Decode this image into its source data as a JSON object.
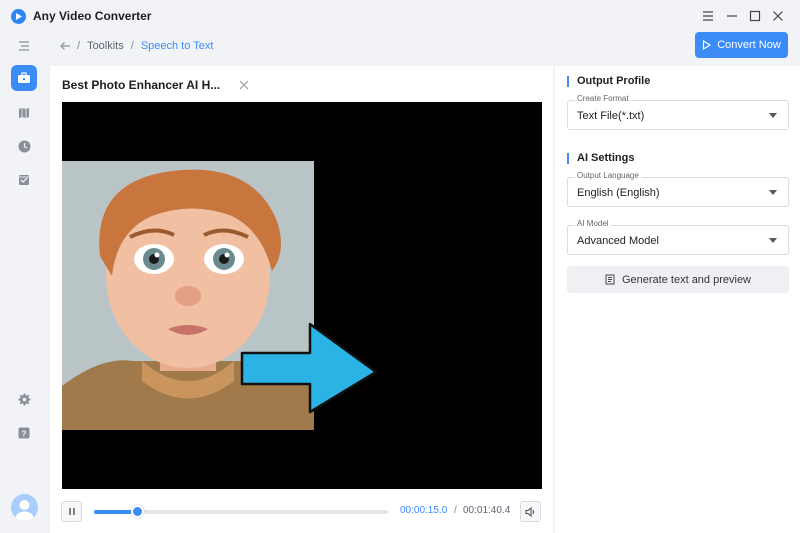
{
  "app": {
    "title": "Any Video Converter"
  },
  "breadcrumb": {
    "root": "Toolkits",
    "separator": "/",
    "current": "Speech to Text"
  },
  "toolbar": {
    "convert_label": "Convert Now"
  },
  "player": {
    "file_title": "Best Photo Enhancer AI H...",
    "current_time": "00:00:15.0",
    "time_separator": "/",
    "total_time": "00:01:40.4",
    "progress_fraction": 0.149
  },
  "output_profile": {
    "title": "Output Profile",
    "format_label": "Create Format",
    "format_value": "Text File(*.txt)"
  },
  "ai_settings": {
    "title": "AI Settings",
    "language_label": "Output Language",
    "language_value": "English (English)",
    "model_label": "AI Model",
    "model_value": "Advanced Model",
    "generate_label": "Generate text and preview"
  },
  "colors": {
    "accent": "#3b8cf7",
    "background": "#f1f3f7",
    "video_bg": "#000000",
    "arrow": "#2bb3e6"
  },
  "icons": {
    "sidebar": [
      "menu-icon",
      "toolbox-icon",
      "map-icon",
      "clock-icon",
      "checklist-icon",
      "settings-icon",
      "help-icon"
    ],
    "window": [
      "hamburger-icon",
      "minimize-icon",
      "maximize-icon",
      "close-icon"
    ]
  }
}
